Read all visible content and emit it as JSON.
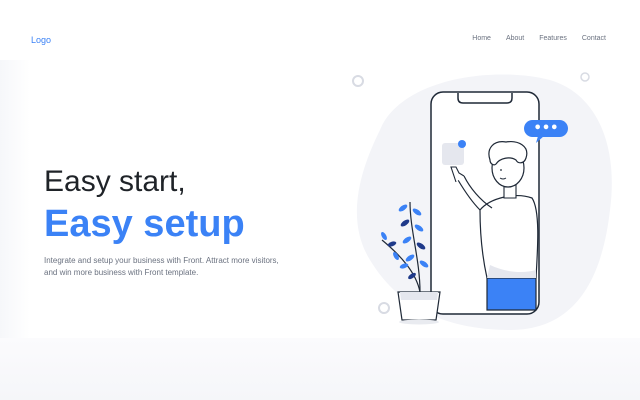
{
  "header": {
    "logo": "Logo",
    "nav": [
      "Home",
      "About",
      "Features",
      "Contact"
    ]
  },
  "hero": {
    "title_line1": "Easy start,",
    "title_line2": "Easy setup",
    "description": "Integrate and setup your business with Front. Attract more visitors, and win more business with Front template."
  },
  "illustration": {
    "chat_bubble_text": "•••"
  },
  "colors": {
    "accent": "#3b82f6",
    "text_dark": "#1f2328",
    "text_muted": "#6b7280",
    "blob": "#f3f4f8",
    "outline": "#1f2937"
  }
}
